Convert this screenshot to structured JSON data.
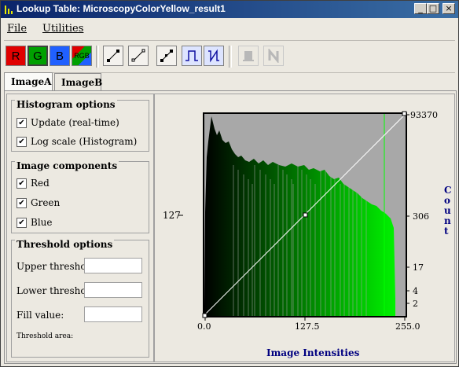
{
  "window": {
    "title": "Lookup Table: MicroscopyColorYellow_result1",
    "min_label": "_",
    "max_label": "□",
    "close_label": "×"
  },
  "menubar": {
    "file": "File",
    "utilities": "Utilities"
  },
  "toolbar": {
    "red": "R",
    "green": "G",
    "blue": "B",
    "rgb": "RGB"
  },
  "tabs": [
    {
      "label": "ImageA",
      "active": true
    },
    {
      "label": "ImageB",
      "active": false
    }
  ],
  "histogram_options": {
    "title": "Histogram options",
    "update": {
      "label": "Update (real-time)",
      "checked": true
    },
    "log_scale": {
      "label": "Log scale (Histogram)",
      "checked": true
    }
  },
  "image_components": {
    "title": "Image components",
    "red": {
      "label": "Red",
      "checked": true
    },
    "green": {
      "label": "Green",
      "checked": true
    },
    "blue": {
      "label": "Blue",
      "checked": true
    }
  },
  "threshold_options": {
    "title": "Threshold options",
    "upper_label": "Upper threshold:",
    "upper_value": "",
    "lower_label": "Lower threshold:",
    "lower_value": "",
    "fill_label": "Fill value:",
    "fill_value": "",
    "area_label": "Threshold area:"
  },
  "plot": {
    "left_tick": "127",
    "right_ticks": [
      "93370",
      "306",
      "17",
      "4",
      "2"
    ],
    "x_ticks": [
      "0.0",
      "127.5",
      "255.0"
    ],
    "xlabel": "Image Intensities",
    "ylabel": "Count"
  }
}
